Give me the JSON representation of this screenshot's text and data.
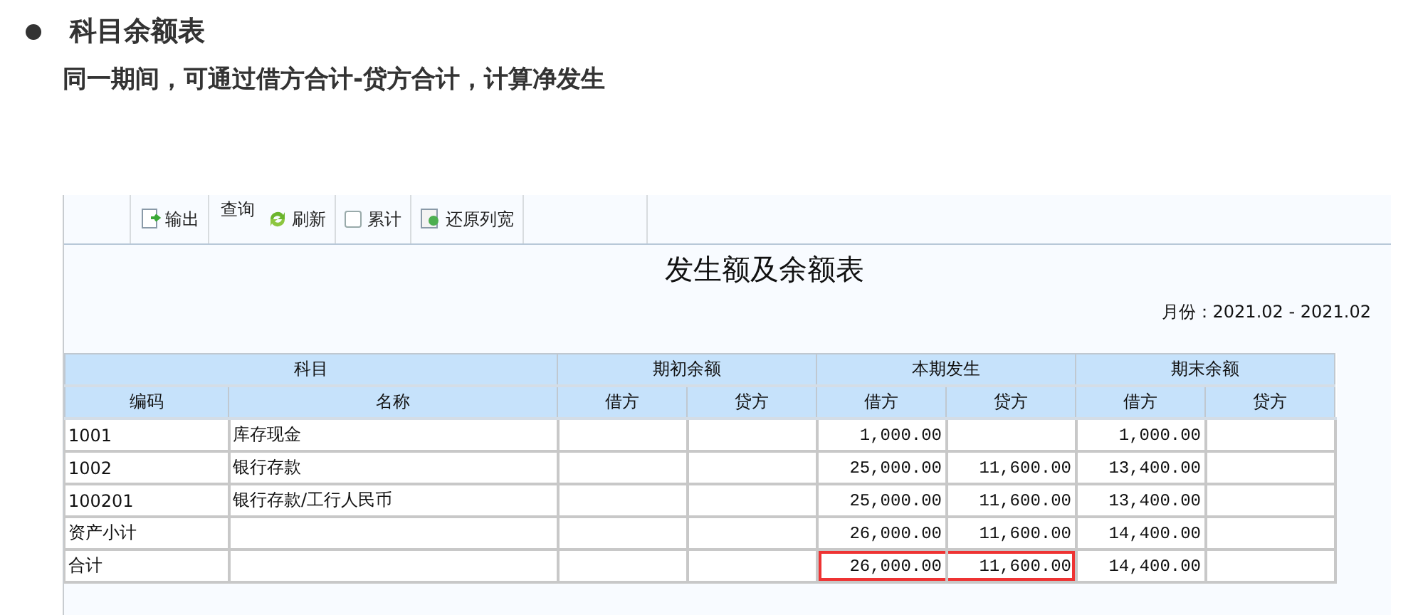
{
  "slide": {
    "heading": "科目余额表",
    "subheading": "同一期间，可通过借方合计-贷方合计，计算净发生"
  },
  "toolbar": [
    {
      "kind": "button",
      "label": "输出"
    },
    {
      "kind": "text",
      "label": "查询"
    },
    {
      "kind": "button",
      "label": "刷新"
    },
    {
      "kind": "checkbox",
      "label": "累计",
      "checked": false
    },
    {
      "kind": "button",
      "label": "还原列宽"
    }
  ],
  "report": {
    "title": "发生额及余额表",
    "period": "月份：2021.02 - 2021.02"
  },
  "table": {
    "groups": [
      "科目",
      "期初余额",
      "本期发生",
      "期末余额"
    ],
    "columns": [
      "编码",
      "名称",
      "借方",
      "贷方",
      "借方",
      "贷方",
      "借方",
      "贷方"
    ],
    "rows": [
      {
        "cells": [
          {
            "text": "1001"
          },
          {
            "text": "库存现金"
          },
          {
            "text": ""
          },
          {
            "text": ""
          },
          {
            "text": "1,000.00"
          },
          {
            "text": ""
          },
          {
            "text": "1,000.00"
          },
          {
            "text": ""
          }
        ]
      },
      {
        "cells": [
          {
            "text": "1002"
          },
          {
            "text": "银行存款"
          },
          {
            "text": ""
          },
          {
            "text": ""
          },
          {
            "text": "25,000.00"
          },
          {
            "text": "11,600.00"
          },
          {
            "text": "13,400.00"
          },
          {
            "text": ""
          }
        ]
      },
      {
        "cells": [
          {
            "text": "100201"
          },
          {
            "text": "银行存款/工行人民币"
          },
          {
            "text": ""
          },
          {
            "text": ""
          },
          {
            "text": "25,000.00"
          },
          {
            "text": "11,600.00"
          },
          {
            "text": "13,400.00"
          },
          {
            "text": ""
          }
        ]
      },
      {
        "cells": [
          {
            "text": "资产小计"
          },
          {
            "text": ""
          },
          {
            "text": ""
          },
          {
            "text": ""
          },
          {
            "text": "26,000.00"
          },
          {
            "text": "11,600.00"
          },
          {
            "text": "14,400.00"
          },
          {
            "text": ""
          }
        ]
      },
      {
        "cells": [
          {
            "text": "合计"
          },
          {
            "text": ""
          },
          {
            "text": ""
          },
          {
            "text": ""
          },
          {
            "text": "26,000.00",
            "highlighted": true
          },
          {
            "text": "11,600.00",
            "highlighted": true
          },
          {
            "text": "14,400.00"
          },
          {
            "text": ""
          }
        ]
      }
    ]
  }
}
